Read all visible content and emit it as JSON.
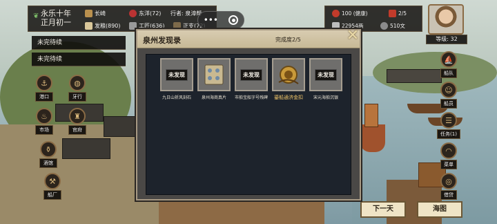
{
  "top_left": {
    "year": "永乐十年",
    "month": "正月初一",
    "location": "长崎",
    "fleet": "东洋(72)",
    "trader": "行者: 泉漳帮",
    "food": "发粮(890)",
    "labor": "工匠(636)",
    "supplies": "正支(72)"
  },
  "banners": [
    "未完待续",
    "未完待续"
  ],
  "left_buttons": [
    {
      "label": "港口",
      "icon": "anchor-icon"
    },
    {
      "label": "牙行",
      "icon": "barrel-icon"
    },
    {
      "label": "市场",
      "icon": "lantern-icon"
    },
    {
      "label": "官府",
      "icon": "seal-icon"
    },
    {
      "label": "酒馆",
      "icon": "jar-icon"
    },
    {
      "label": "船厂",
      "icon": "hammer-icon"
    }
  ],
  "right_status": {
    "health": "100 (健康)",
    "crew": "2/5",
    "silver": "22954两",
    "coins": "510文"
  },
  "level": "等级: 32",
  "right_buttons": [
    {
      "label": "船队",
      "icon": "ship-icon"
    },
    {
      "label": "船员",
      "icon": "crew-icon"
    },
    {
      "label": "任务(1)",
      "icon": "scroll-icon"
    },
    {
      "label": "菜单",
      "icon": "fan-icon"
    },
    {
      "label": "借贷",
      "icon": "coin-icon"
    }
  ],
  "bottom": {
    "next_day": "下一天",
    "sea_chart": "海图"
  },
  "dialog": {
    "title": "泉州发现录",
    "progress": "完成度2/5",
    "close": "✕",
    "items": [
      {
        "state": "未发现",
        "label": "九日山祈风刻石",
        "found": false
      },
      {
        "label": "泉州海商真片",
        "found": true
      },
      {
        "state": "未发现",
        "label": "市舶宝船字号残碑",
        "found": false
      },
      {
        "label": "鎏船通济金扣",
        "found": true,
        "gold": true
      },
      {
        "state": "未发现",
        "label": "宋元海舶沉银",
        "found": false
      }
    ]
  },
  "colors": {
    "panel": "#1d232c",
    "header": "#d8ccb1",
    "gold": "#f2c76a"
  }
}
